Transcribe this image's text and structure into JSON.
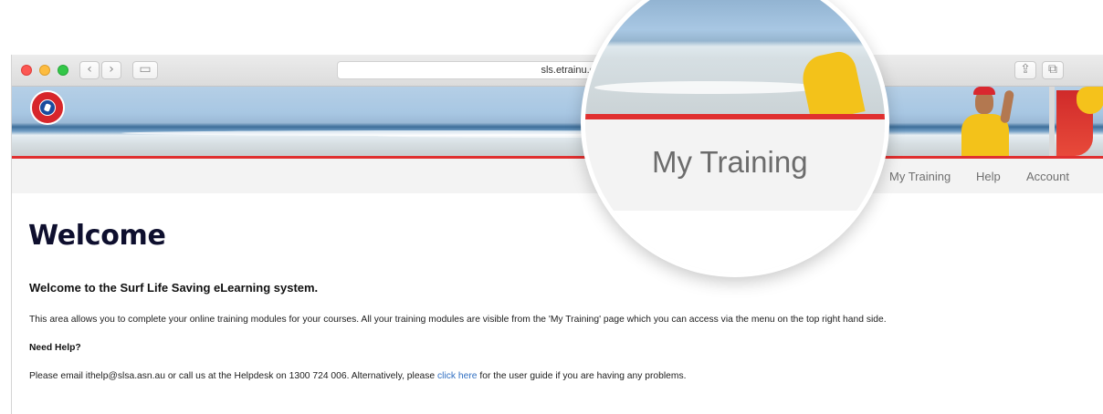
{
  "browser": {
    "url": "sls.etrainu.com/training",
    "back_glyph": "‹",
    "forward_glyph": "›",
    "sidebar_glyph": "▭",
    "share_glyph": "⇪",
    "tabs_glyph": "⧉"
  },
  "nav": {
    "items": [
      {
        "label": "My Training"
      },
      {
        "label": "Help"
      },
      {
        "label": "Account"
      }
    ]
  },
  "magnifier": {
    "label": "My Training"
  },
  "content": {
    "title": "Welcome",
    "subtitle": "Welcome to the Surf Life Saving eLearning system.",
    "intro": "This area allows you to complete your online training modules for your courses. All your training modules are visible from the 'My Training' page which you can access via the menu on the top right hand side.",
    "need_help": "Need Help?",
    "help_before": "Please email ithelp@slsa.asn.au or call us at the Helpdesk on 1300 724 006. Alternatively, please ",
    "help_link": "click here",
    "help_after": " for the user guide if you are having any problems."
  },
  "colors": {
    "accent_red": "#e02f2f",
    "link_blue": "#2f6ec1",
    "title_navy": "#0e0f2e"
  },
  "icons": {
    "logo": "surf-life-saving-logo-icon"
  }
}
